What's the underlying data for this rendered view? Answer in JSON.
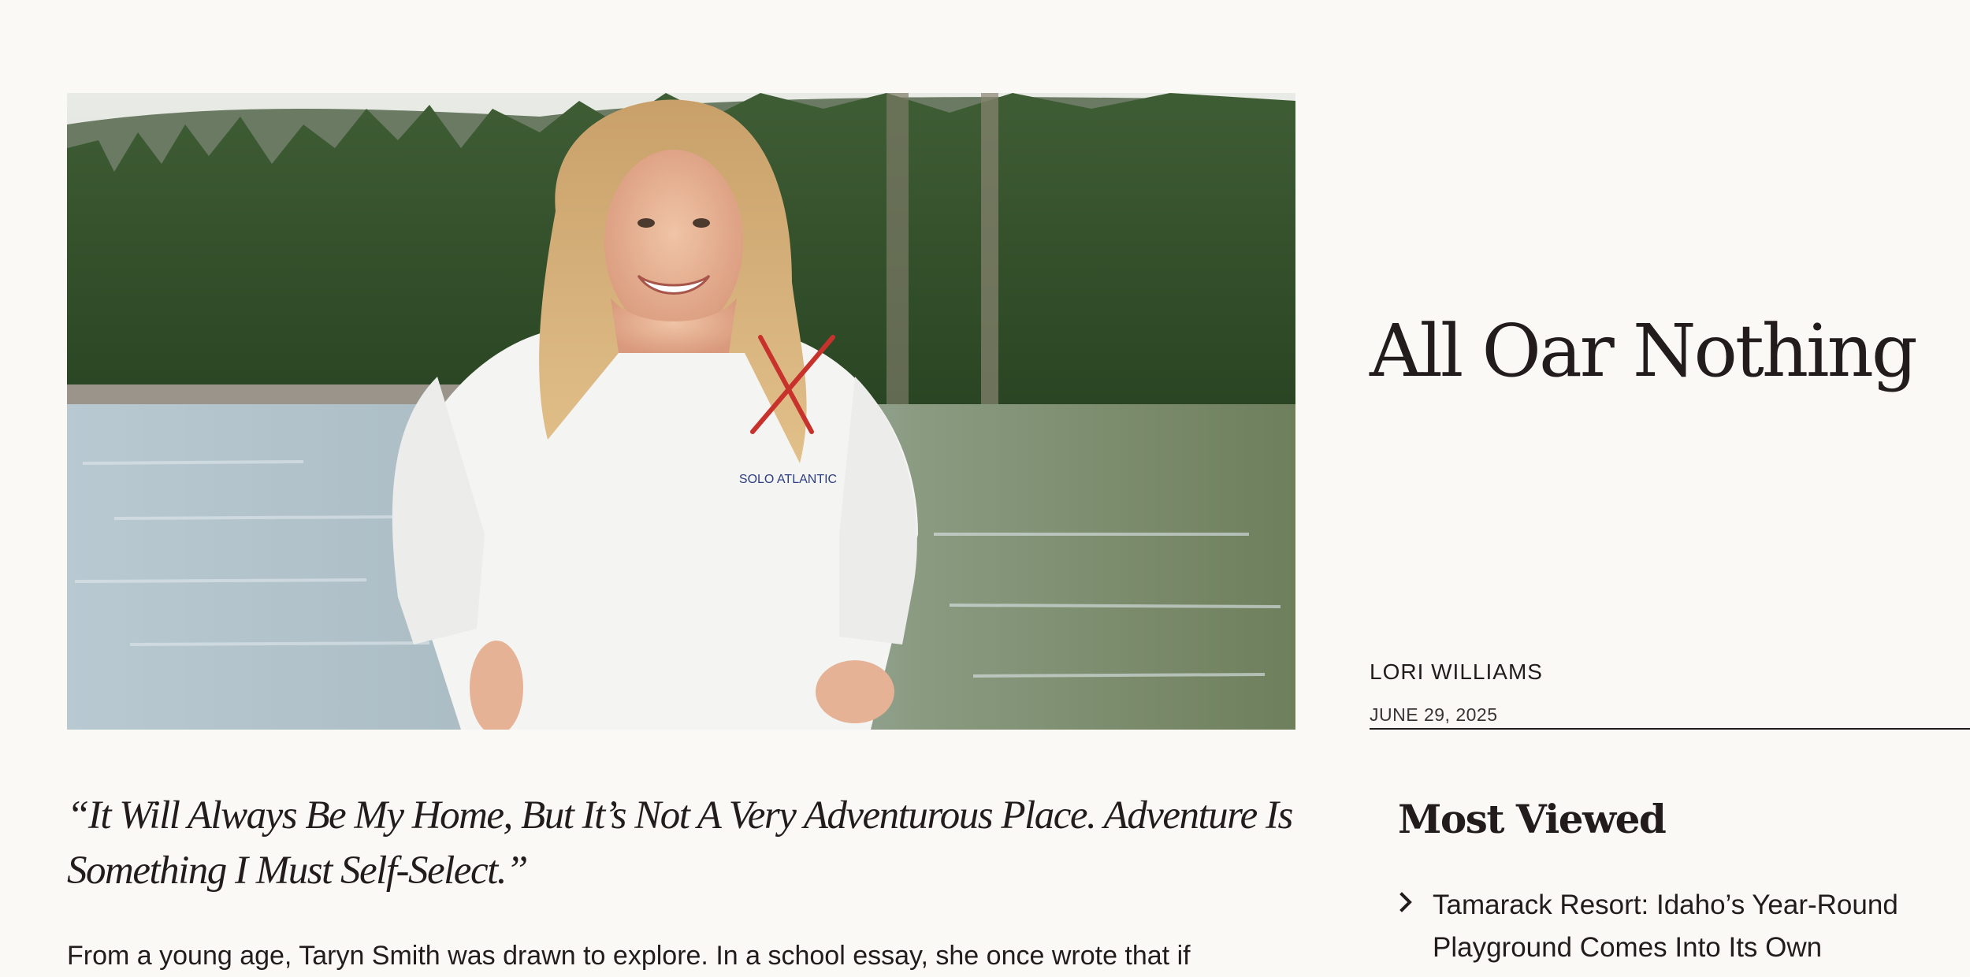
{
  "article": {
    "title": "All Oar Nothing",
    "author": "LORI WILLIAMS",
    "date": "JUNE 29, 2025",
    "hero_image_icon": "portrait-photo",
    "pull_quote": "“It Will Always Be My Home, But It’s Not A Very Adventurous Place. Adventure Is Something I Must Self-Select.”",
    "body_first_line": "From a young age, Taryn Smith was drawn to explore. In a school essay, she once wrote that if"
  },
  "sidebar": {
    "most_viewed_heading": "Most Viewed",
    "items": [
      {
        "label": "Tamarack Resort: Idaho’s Year-Round Playground Comes Into Its Own",
        "icon": "chevron-right-icon"
      }
    ]
  },
  "colors": {
    "page_background": "#faf9f6",
    "text": "#231c1c"
  }
}
